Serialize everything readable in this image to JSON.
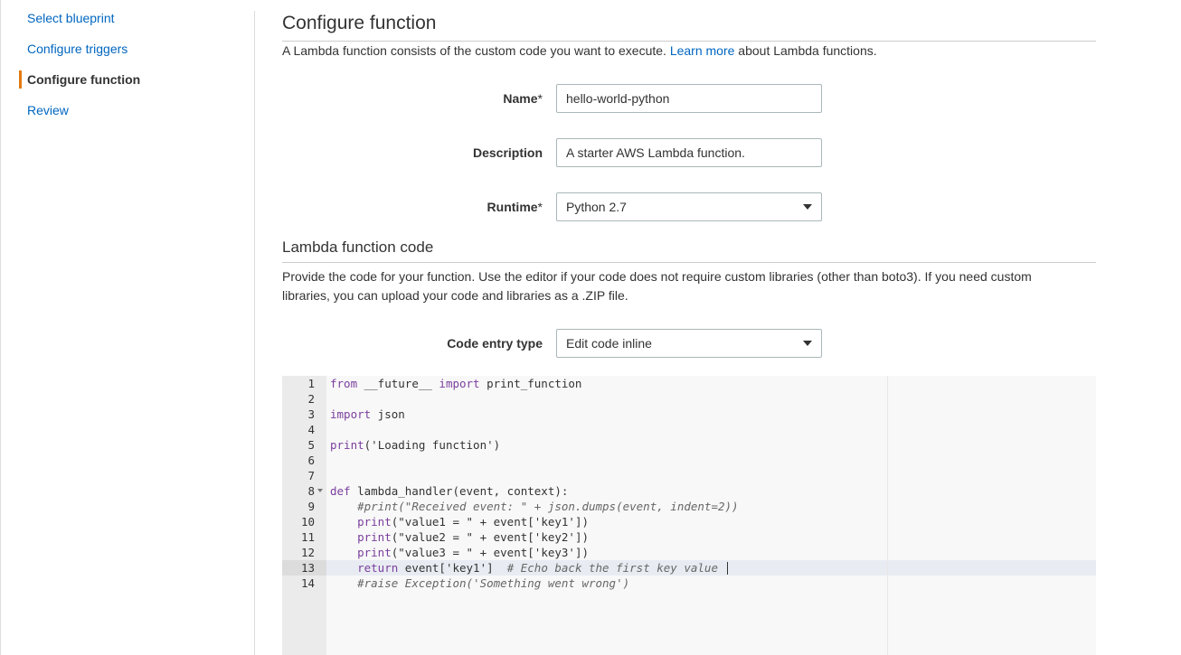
{
  "sidebar": {
    "items": [
      {
        "label": "Select blueprint",
        "active": false
      },
      {
        "label": "Configure triggers",
        "active": false
      },
      {
        "label": "Configure function",
        "active": true
      },
      {
        "label": "Review",
        "active": false
      }
    ]
  },
  "main": {
    "title": "Configure function",
    "intro_prefix": "A Lambda function consists of the custom code you want to execute.",
    "intro_link": "Learn more",
    "intro_suffix": "about Lambda functions.",
    "fields": {
      "name_label": "Name",
      "name_value": "hello-world-python",
      "description_label": "Description",
      "description_value": "A starter AWS Lambda function.",
      "runtime_label": "Runtime",
      "runtime_value": "Python 2.7",
      "required_mark": "*"
    },
    "code_section": {
      "title": "Lambda function code",
      "description": "Provide the code for your function. Use the editor if your code does not require custom libraries (other than boto3). If you need custom libraries, you can upload your code and libraries as a .ZIP file.",
      "entry_type_label": "Code entry type",
      "entry_type_value": "Edit code inline"
    }
  },
  "editor": {
    "active_line": 13,
    "lines": [
      {
        "n": "1",
        "code": "from __future__ import print_function"
      },
      {
        "n": "2",
        "code": ""
      },
      {
        "n": "3",
        "code": "import json"
      },
      {
        "n": "4",
        "code": ""
      },
      {
        "n": "5",
        "code": "print('Loading function')"
      },
      {
        "n": "6",
        "code": ""
      },
      {
        "n": "7",
        "code": ""
      },
      {
        "n": "8",
        "code": "def lambda_handler(event, context):"
      },
      {
        "n": "9",
        "code": "    #print(\"Received event: \" + json.dumps(event, indent=2))"
      },
      {
        "n": "10",
        "code": "    print(\"value1 = \" + event['key1'])"
      },
      {
        "n": "11",
        "code": "    print(\"value2 = \" + event['key2'])"
      },
      {
        "n": "12",
        "code": "    print(\"value3 = \" + event['key3'])"
      },
      {
        "n": "13",
        "code": "    return event['key1']  # Echo back the first key value"
      },
      {
        "n": "14",
        "code": "    #raise Exception('Something went wrong')"
      }
    ]
  },
  "colors": {
    "link": "#0066c0",
    "active_indicator": "#e47911",
    "keyword": "#7a3e9d"
  }
}
